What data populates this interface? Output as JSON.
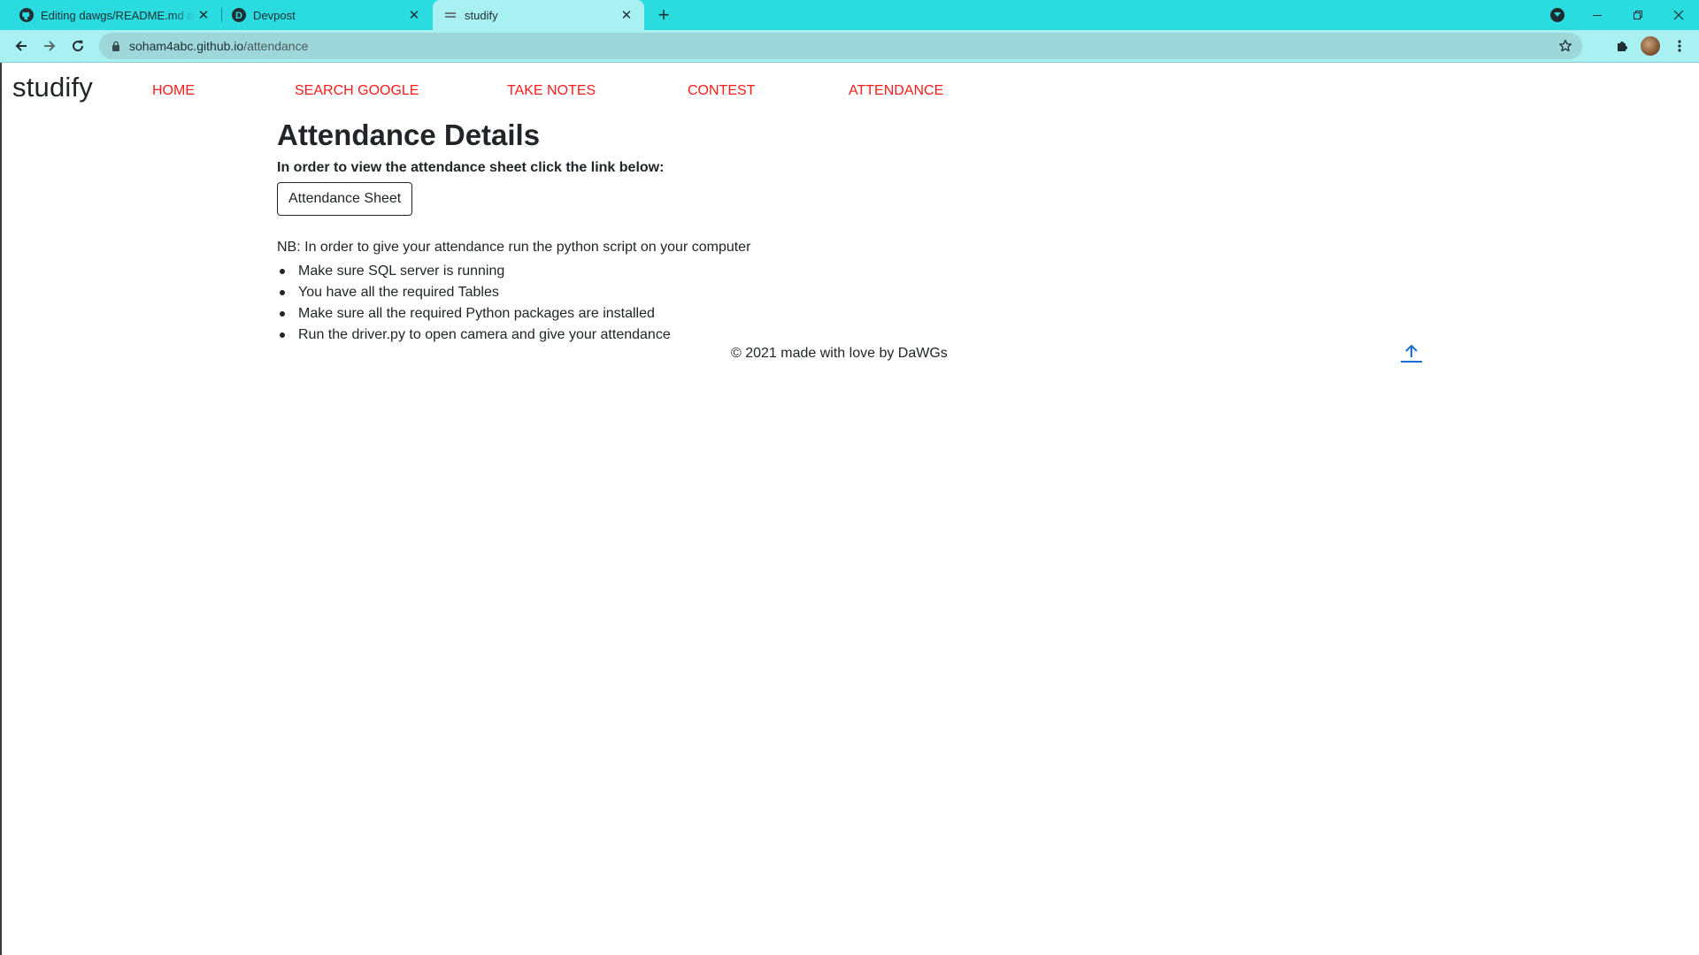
{
  "browser": {
    "tabs": [
      {
        "title": "Editing dawgs/README.md at m",
        "favicon": "github-icon",
        "active": false
      },
      {
        "title": "Devpost",
        "favicon": "devpost-icon",
        "active": false
      },
      {
        "title": "studify",
        "favicon": "page-icon",
        "active": true
      }
    ],
    "new_tab_label": "+",
    "url_host": "soham4abc.github.io",
    "url_path": "/attendance",
    "accent": "#2adbe0",
    "toolbar_color": "#a8f0f1"
  },
  "site": {
    "brand": "studify",
    "nav": [
      "HOME",
      "SEARCH GOOGLE",
      "TAKE NOTES",
      "CONTEST",
      "ATTENDANCE"
    ],
    "nav_color": "#ff1a1a"
  },
  "main": {
    "heading": "Attendance Details",
    "intro": "In order to view the attendance sheet click the link below:",
    "sheet_button": "Attendance Sheet",
    "note": "NB: In order to give your attendance run the python script on your computer",
    "steps": [
      "Make sure SQL server is running",
      "You have all the required Tables",
      "Make sure all the required Python packages are installed",
      "Run the driver.py to open camera and give your attendance"
    ]
  },
  "footer": {
    "text": "© 2021 made with love by DaWGs",
    "top_icon": "arrow-up-icon",
    "icon_color": "#1a6fd1"
  }
}
